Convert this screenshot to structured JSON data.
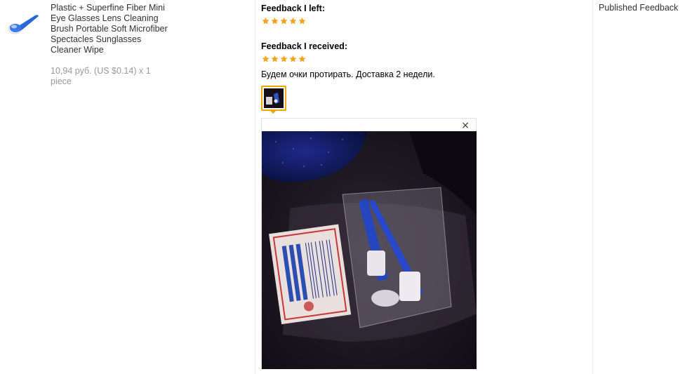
{
  "product": {
    "title": "Plastic + Superfine Fiber Mini Eye Glasses Lens Cleaning Brush Portable Soft Microfiber Spectacles Sunglasses Cleaner Wipe",
    "price_line": "10,94 руб. (US $0.14) x 1 piece"
  },
  "feedback": {
    "left_label": "Feedback I left:",
    "left_rating": 5,
    "received_label": "Feedback I received:",
    "received_rating": 5,
    "received_text": "Будем очки протирать. Доставка 2 недели.",
    "star_color": "#f7a21b"
  },
  "viewer": {
    "close_glyph": "×"
  },
  "status": {
    "label": "Published Feedback"
  }
}
